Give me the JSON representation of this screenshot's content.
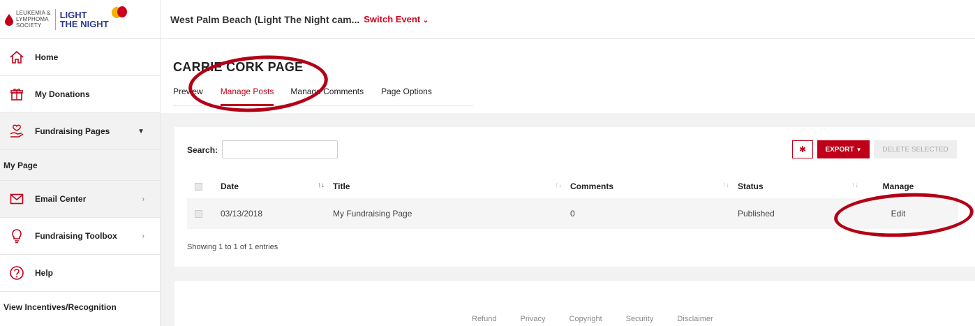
{
  "logo": {
    "org_line1": "LEUKEMIA &",
    "org_line2": "LYMPHOMA",
    "org_line3": "SOCIETY",
    "campaign_line1": "LIGHT",
    "campaign_line2": "THE NIGHT"
  },
  "sidebar": {
    "items": [
      {
        "label": "Home",
        "icon": "home-icon"
      },
      {
        "label": "My Donations",
        "icon": "gift-icon"
      },
      {
        "label": "Fundraising Pages",
        "icon": "hand-heart-icon"
      },
      {
        "label": "My Page"
      },
      {
        "label": "Email Center",
        "icon": "envelope-icon"
      },
      {
        "label": "Fundraising Toolbox",
        "icon": "lightbulb-icon"
      },
      {
        "label": "Help",
        "icon": "question-icon"
      },
      {
        "label": "View Incentives/Recognition"
      }
    ]
  },
  "topbar": {
    "event": "West Palm Beach (Light The Night cam...",
    "switch_label": "Switch Event"
  },
  "page": {
    "title": "CARRIE CORK PAGE",
    "tabs": [
      "Preview",
      "Manage Posts",
      "Manage Comments",
      "Page Options"
    ],
    "active_tab": "Manage Posts"
  },
  "toolbar": {
    "search_label": "Search:",
    "search_value": "",
    "export_label": "EXPORT",
    "delete_label": "DELETE SELECTED"
  },
  "table": {
    "headers": [
      "Date",
      "Title",
      "Comments",
      "Status",
      "Manage"
    ],
    "rows": [
      {
        "date": "03/13/2018",
        "title": "My Fundraising Page",
        "comments": "0",
        "status": "Published",
        "manage": "Edit"
      }
    ],
    "summary": "Showing 1 to 1 of 1 entries"
  },
  "footer": {
    "links": [
      "Refund",
      "Privacy",
      "Copyright",
      "Security",
      "Disclaimer"
    ]
  },
  "colors": {
    "accent": "#c00018",
    "brand_blue": "#2b3a8f"
  }
}
